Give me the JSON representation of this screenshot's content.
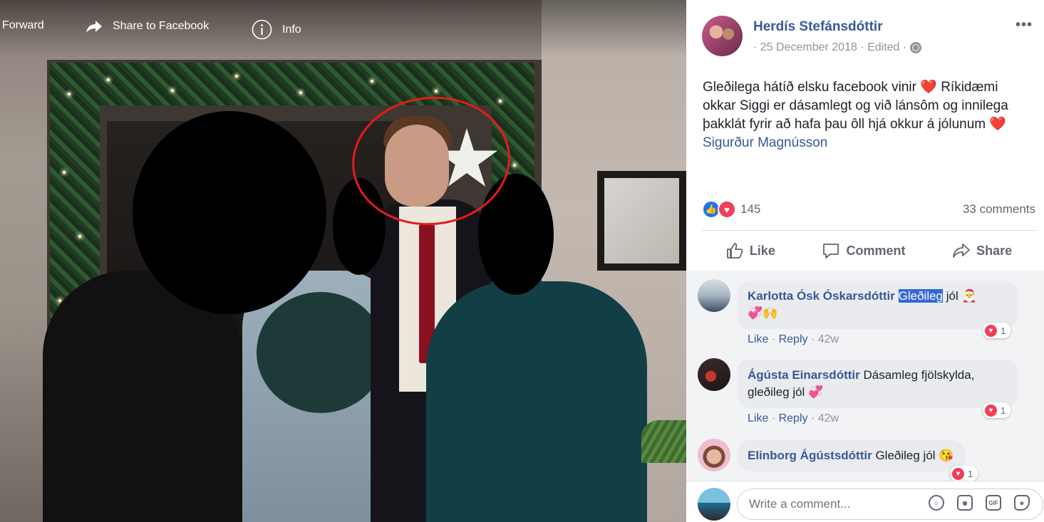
{
  "photo_bar": {
    "forward": "Forward",
    "share_fb": "Share to Facebook",
    "info": "Info"
  },
  "post": {
    "author": "Herdís Stefánsdóttir",
    "date": "· 25 December 2018 · Edited ·",
    "text_1": "Gleðilega hátíð elsku facebook vinir",
    "text_2": "Ríkidæmi okkar Siggi er dásamlegt og við lánsôm og innilega þakklát fyrir að hafa þau ôll hjá okkur á jólunum",
    "heart": "❤️",
    "tagged": "Sigurður Magnússon",
    "reaction_count": "145",
    "comment_count": "33 comments",
    "more": "•••"
  },
  "actions": {
    "like": "Like",
    "comment": "Comment",
    "share": "Share"
  },
  "comments": [
    {
      "name": "Karlotta Ósk Óskarsdóttir",
      "highlight": "Gleðileg",
      "text": "jól 🎅",
      "text2": "💞🙌",
      "like": "Like",
      "reply": "Reply",
      "time": "42w",
      "reactions": "1"
    },
    {
      "name": "Ágústa Einarsdóttir",
      "text": "Dásamleg fjölskylda,",
      "text2": "gleðileg jól 💞",
      "like": "Like",
      "reply": "Reply",
      "time": "42w",
      "reactions": "1"
    },
    {
      "name": "Elinborg Ágústsdóttir",
      "text": "Gleðileg jól 😘",
      "reactions": "1"
    }
  ],
  "composer": {
    "placeholder": "Write a comment...",
    "gif": "GIF"
  },
  "icons": {
    "accent": "#385898",
    "like": "#1877f2",
    "love": "#f33e58"
  }
}
